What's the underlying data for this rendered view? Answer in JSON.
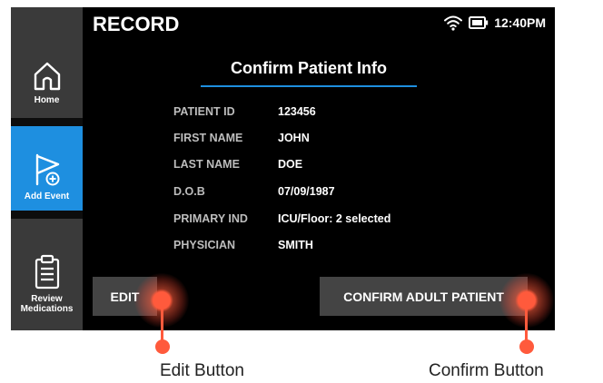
{
  "header": {
    "app_title": "RECORD",
    "time": "12:40PM",
    "wifi_icon": "wifi-icon",
    "battery_icon": "battery-icon"
  },
  "sidebar": {
    "items": [
      {
        "label": "Home",
        "icon": "home-icon"
      },
      {
        "label": "Add Event",
        "icon": "flag-plus-icon",
        "active": true
      },
      {
        "label": "Review\nMedications",
        "icon": "clipboard-icon"
      }
    ]
  },
  "main": {
    "title": "Confirm Patient Info",
    "fields": [
      {
        "label": "PATIENT ID",
        "value": "123456"
      },
      {
        "label": "FIRST NAME",
        "value": "JOHN"
      },
      {
        "label": "LAST NAME",
        "value": "DOE"
      },
      {
        "label": "D.O.B",
        "value": "07/09/1987"
      },
      {
        "label": "PRIMARY IND",
        "value": "ICU/Floor: 2 selected"
      },
      {
        "label": "PHYSICIAN",
        "value": "SMITH"
      }
    ],
    "edit_label": "EDIT",
    "confirm_label": "CONFIRM ADULT PATIENT"
  },
  "callouts": {
    "edit": "Edit Button",
    "confirm": "Confirm Button"
  },
  "colors": {
    "accent": "#1e8fe0",
    "touch": "#ff5a3c",
    "button": "#444444",
    "background": "#000000"
  }
}
